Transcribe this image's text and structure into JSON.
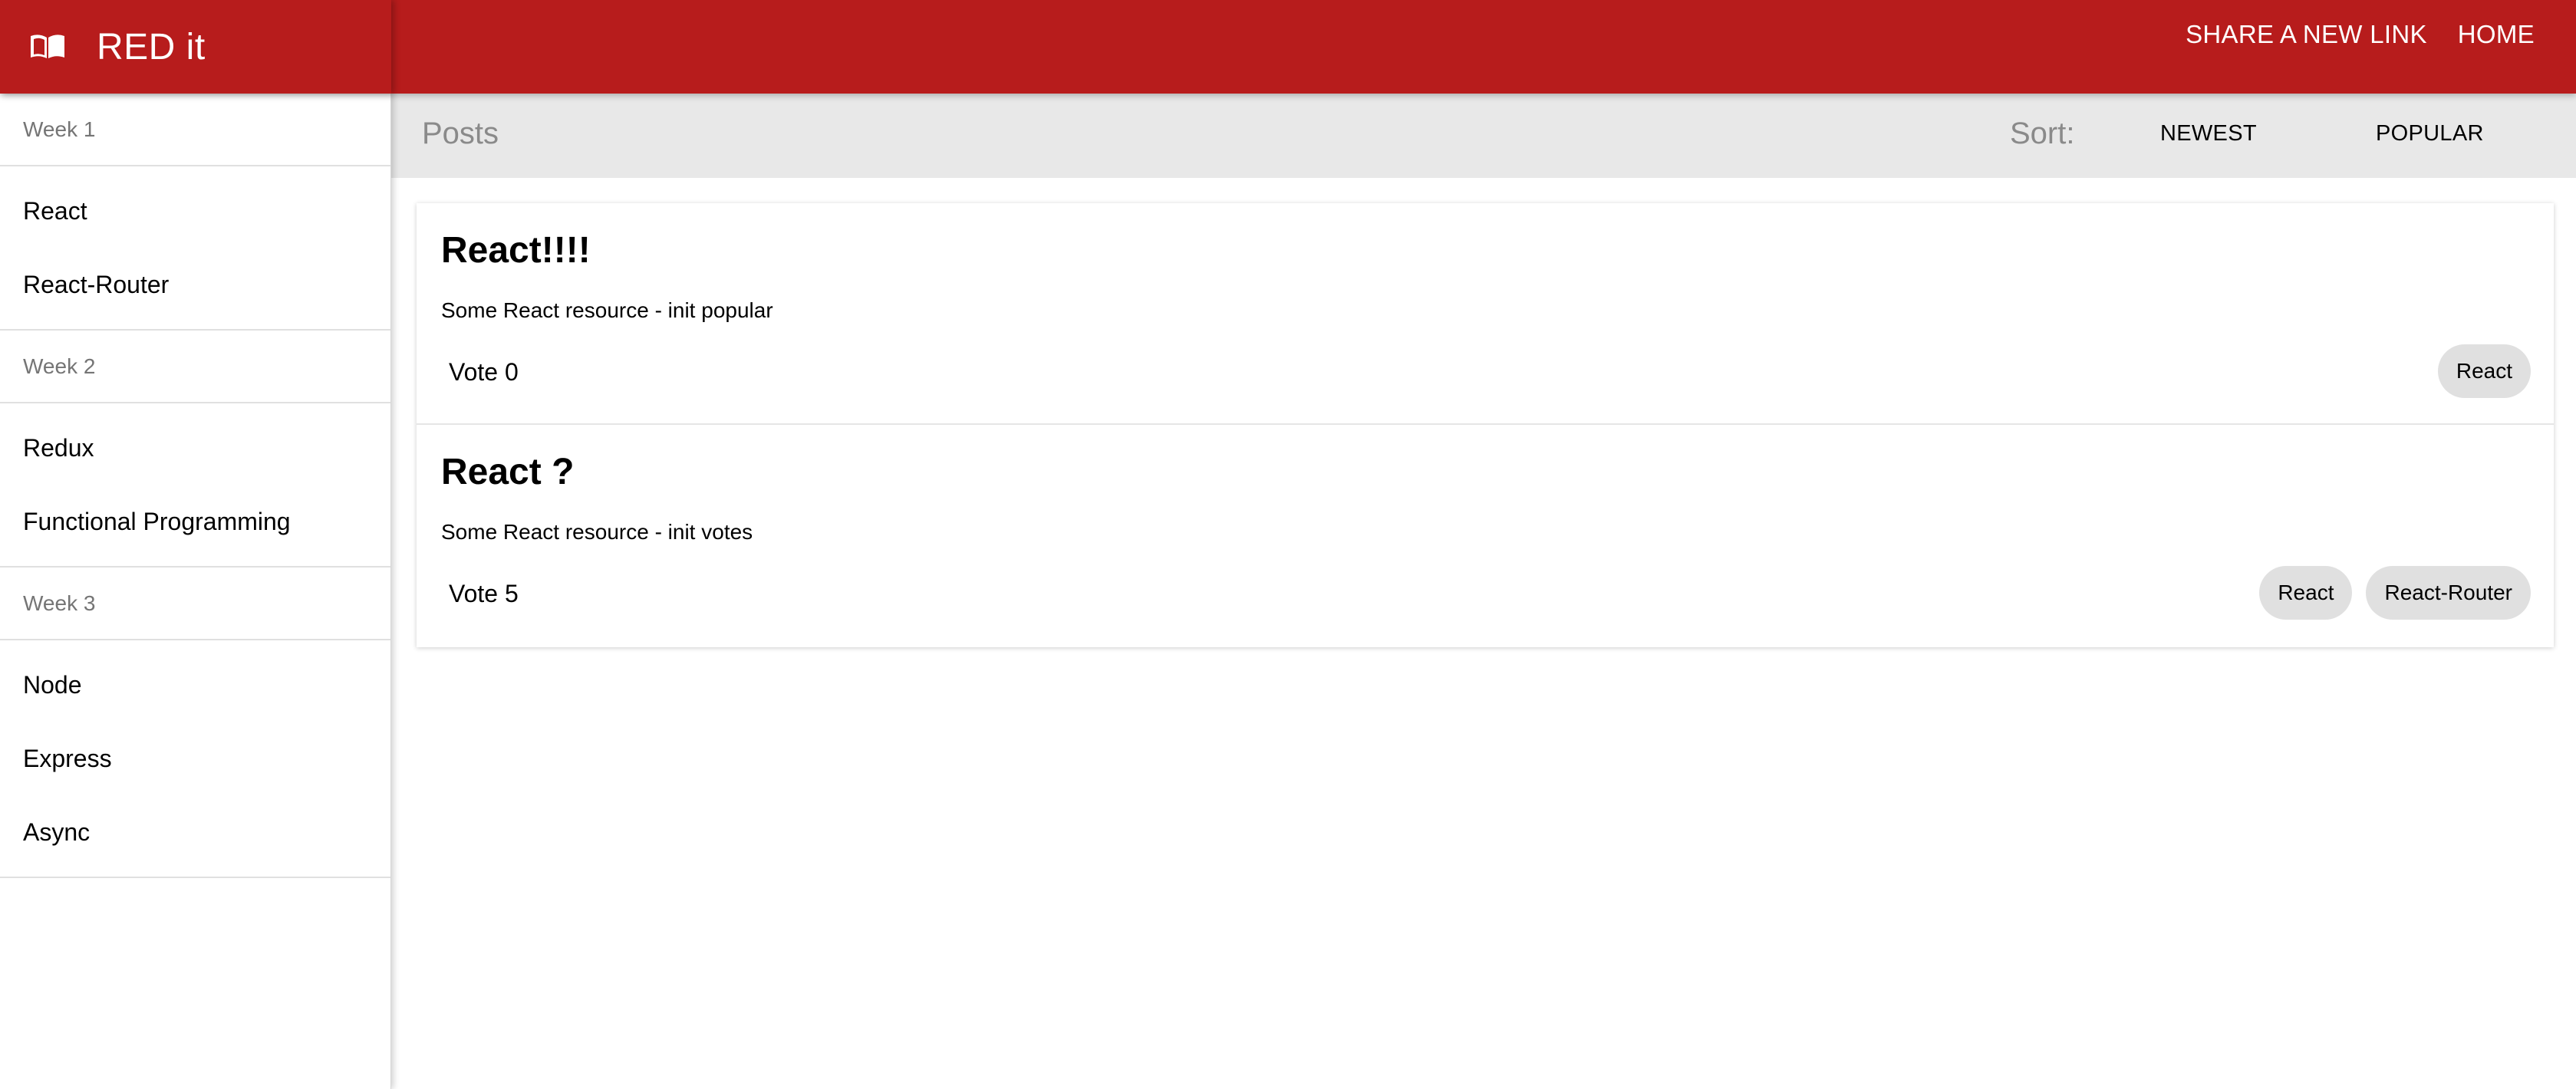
{
  "app": {
    "title": "RED it",
    "icon": "book-open-icon"
  },
  "top_nav": {
    "share_link_label": "SHARE A NEW LINK",
    "home_label": "HOME"
  },
  "sidebar": {
    "weeks": [
      {
        "label": "Week 1",
        "items": [
          "React",
          "React-Router"
        ]
      },
      {
        "label": "Week 2",
        "items": [
          "Redux",
          "Functional Programming"
        ]
      },
      {
        "label": "Week 3",
        "items": [
          "Node",
          "Express",
          "Async"
        ]
      }
    ]
  },
  "posts_header": {
    "title": "Posts",
    "sort_label": "Sort:",
    "sort_newest": "NEWEST",
    "sort_popular": "POPULAR"
  },
  "posts": [
    {
      "title": "React!!!!",
      "description": "Some React resource - init popular",
      "vote": "Vote 0",
      "tags": [
        "React"
      ]
    },
    {
      "title": "React ?",
      "description": "Some React resource - init votes",
      "vote": "Vote 5",
      "tags": [
        "React",
        "React-Router"
      ]
    }
  ],
  "colors": {
    "brand": "#b71c1c",
    "subbar": "#e8e8e8",
    "tag_bg": "#e0e0e0",
    "muted_text": "#757575"
  }
}
